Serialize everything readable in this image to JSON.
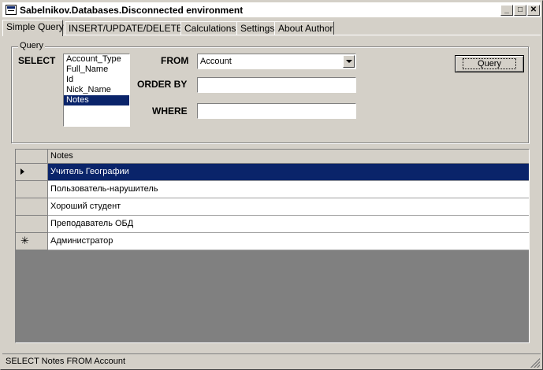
{
  "window": {
    "title": "Sabelnikov.Databases.Disconnected environment",
    "controls": {
      "minimize": "_",
      "maximize": "□",
      "close": "✕"
    }
  },
  "tabs": [
    {
      "label": "Simple Query",
      "active": true
    },
    {
      "label": "INSERT/UPDATE/DELETE",
      "active": false
    },
    {
      "label": "Calculations",
      "active": false
    },
    {
      "label": "Settings",
      "active": false
    },
    {
      "label": "About Author",
      "active": false
    }
  ],
  "query": {
    "group_title": "Query",
    "select_label": "SELECT",
    "fields": [
      "Account_Type",
      "Full_Name",
      "Id",
      "Nick_Name",
      "Notes"
    ],
    "selected_field": "Notes",
    "from_label": "FROM",
    "from_value": "Account",
    "orderby_label": "ORDER BY",
    "orderby_value": "",
    "where_label": "WHERE",
    "where_value": "",
    "button_label": "Query"
  },
  "grid": {
    "column": "Notes",
    "rows": [
      {
        "value": "Учитель Географии",
        "selected": true,
        "marker": "current"
      },
      {
        "value": "Пользователь-нарушитель",
        "selected": false,
        "marker": ""
      },
      {
        "value": "Хороший студент",
        "selected": false,
        "marker": ""
      },
      {
        "value": "Преподаватель ОБД",
        "selected": false,
        "marker": ""
      },
      {
        "value": "Администратор",
        "selected": false,
        "marker": "new"
      }
    ]
  },
  "status": {
    "text": "SELECT Notes FROM Account"
  },
  "colors": {
    "selection": "#0a246a",
    "face": "#d4d0c8",
    "grid_background": "#808080"
  }
}
